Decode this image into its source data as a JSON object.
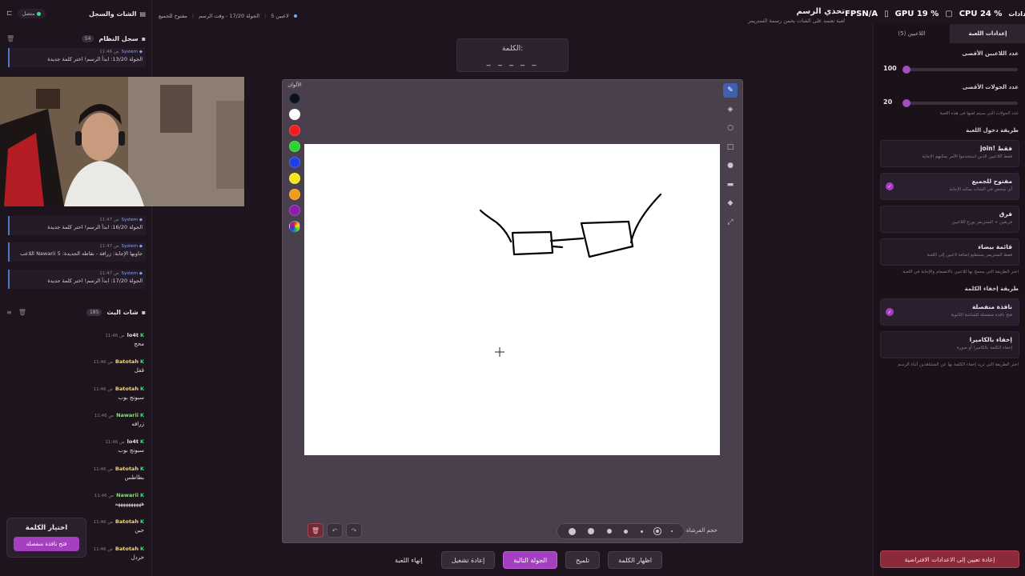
{
  "header": {
    "title": "تحدي الرسم",
    "subtitle": "لعبة تعتمد على الشات يخمن رسمة الستريمر",
    "crumbs": [
      "5 لاعبين",
      "الجولة 17/20 - وقت الرسم",
      "مفتوح للجميع"
    ]
  },
  "perf": {
    "fps_label": "FPS",
    "fps_value": "N/A",
    "gpu_label": "GPU",
    "gpu_value": "19 %",
    "cpu_label": "CPU",
    "cpu_value": "24 %",
    "extra": "إعدادات"
  },
  "word": {
    "label": "الكلمة:",
    "blanks": "_ _ _ _ _"
  },
  "palette": {
    "label": "الألوان",
    "colors": [
      "#0b1020",
      "#ffffff",
      "#ef1f1f",
      "#2ed42e",
      "#1f3fe6",
      "#f5e61c",
      "#f29a1c",
      "#8a1ea8"
    ]
  },
  "tools": [
    "pencil-icon",
    "eraser-icon",
    "circle-icon",
    "rect-icon",
    "dot-icon",
    "fill-icon",
    "bucket-icon",
    "expand-icon"
  ],
  "brush": {
    "label": "حجم الفرشاة"
  },
  "actions": {
    "end_game": "إنهاء اللعبة",
    "restart": "إعادة تشغيل",
    "next_round": "الجولة التالية",
    "hint": "تلميح",
    "show_word": "اظهار الكلمة"
  },
  "left": {
    "title": "الشات والسجل",
    "status": "متصل",
    "log": {
      "title": "سجل النظام",
      "count": "54",
      "items": [
        {
          "sender": "System",
          "time": "11:46 ص",
          "msg": "الجولة 13/20: ابدأ الرسم! اختر كلمة جديدة"
        },
        {
          "sender": "System",
          "time": "11:47 ص",
          "msg": "الجولة 16/20: ابدأ الرسم! اختر كلمة جديدة"
        },
        {
          "sender": "System",
          "time": "11:47 ص",
          "msg": "اللاعب Nawarii جاوبها الإجابة: زرافة - نقاطه الجديدة: 5"
        },
        {
          "sender": "System",
          "time": "11:47 ص",
          "msg": "الجولة 17/20: ابدأ الرسم! اختر كلمة جديدة"
        }
      ]
    },
    "chat": {
      "title": "شات البث",
      "count": "185",
      "items": [
        {
          "user": "lo4t",
          "time": "11:46 ص",
          "msg": "محح",
          "color": "#e8dde6"
        },
        {
          "user": "Batotah",
          "time": "11:46 ص",
          "msg": "قفل",
          "color": "#f5d76e"
        },
        {
          "user": "Batotah",
          "time": "11:46 ص",
          "msg": "سبونج بوب",
          "color": "#f5d76e"
        },
        {
          "user": "Nawarii",
          "time": "11:46 ص",
          "msg": "زرافه",
          "color": "#7ee86b"
        },
        {
          "user": "lo4t",
          "time": "11:46 ص",
          "msg": "سبونج بوب",
          "color": "#e8dde6"
        },
        {
          "user": "Batotah",
          "time": "11:46 ص",
          "msg": "بطاطس",
          "color": "#f5d76e"
        },
        {
          "user": "Nawarii",
          "time": "11:46 ص",
          "msg": "ههههههههههه",
          "color": "#7ee86b"
        },
        {
          "user": "Batotah",
          "time": "11:46 ص",
          "msg": "جبن",
          "color": "#f5d76e"
        },
        {
          "user": "Batotah",
          "time": "11:46 ص",
          "msg": "خردل",
          "color": "#f5d76e"
        }
      ]
    },
    "word_pick": {
      "title": "اختيار الكلمة",
      "button": "فتح نافذة منفصلة"
    }
  },
  "right": {
    "tabs": [
      "اللاعبين (5)",
      "إعدادات اللعبة"
    ],
    "max_players": {
      "label": "عدد اللاعبين الأقصى",
      "value": "100"
    },
    "max_rounds": {
      "label": "عدد الجولات الأقصى",
      "value": "20",
      "hint": "عدد الجولات التي سيتم لعبها في هذه اللعبة"
    },
    "entry": {
      "label": "طريقة دخول اللعبة",
      "options": [
        {
          "title": "join! فقط",
          "desc": "فقط اللاعبين الذين استخدموا الأمر يمكنهم الإجابة",
          "selected": false
        },
        {
          "title": "مفتوح للجميع",
          "desc": "أي شخص في الشات يمكنه الإجابة",
          "selected": true
        },
        {
          "title": "فرق",
          "desc": "فريقين + الستريمر يوزع اللاعبين",
          "selected": false
        },
        {
          "title": "قائمة بيضاء",
          "desc": "فقط الستريمر يستطيع إضافة لاعبين إلى اللعبة",
          "selected": false
        }
      ],
      "hint": "اختر الطريقة التي يسمح بها للاعبين بالانضمام والإجابة في اللعبة"
    },
    "hide": {
      "label": "طريقة إخفاء الكلمة",
      "options": [
        {
          "title": "نافذة منفصلة",
          "desc": "فتح نافذة منفصلة للشاشة الثانوية",
          "selected": true
        },
        {
          "title": "إخفاء بالكاميرا",
          "desc": "إخفاء الكلمة بالكاميرا أو صورة",
          "selected": false
        }
      ],
      "hint": "اختر الطريقة التي تريد إخفاء الكلمة بها عن المشاهدين أثناء الرسم"
    },
    "reset": "إعادة تعيين إلى الاعدادات الافتراضية"
  }
}
